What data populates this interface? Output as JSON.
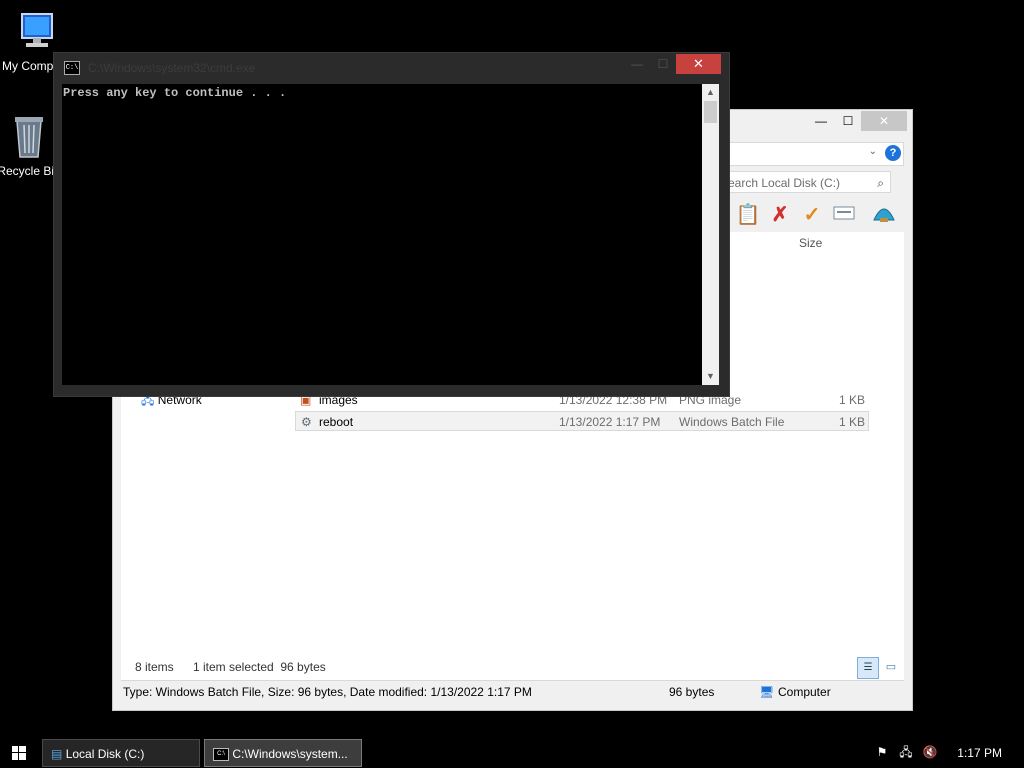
{
  "desktop": {
    "icons": [
      {
        "label": "My Computer",
        "icon": "computer-icon"
      },
      {
        "label": "Recycle Bin",
        "icon": "recycle-bin-icon"
      }
    ]
  },
  "console": {
    "title": "C:\\Windows\\system32\\cmd.exe",
    "output": "Press any key to continue . . .",
    "close_glyph": "✕",
    "min_glyph": "—",
    "max_glyph": "☐"
  },
  "explorer": {
    "search_placeholder": "Search Local Disk (C:)",
    "columns": {
      "size": "Size"
    },
    "nav": {
      "network": "Network"
    },
    "files": [
      {
        "name": "images",
        "date": "1/13/2022 12:38 PM",
        "type": "PNG image",
        "size": "1 KB",
        "icon": "png-file-icon",
        "selected": false
      },
      {
        "name": "reboot",
        "date": "1/13/2022 1:17 PM",
        "type": "Windows Batch File",
        "size": "1 KB",
        "icon": "batch-file-icon",
        "selected": true
      }
    ],
    "status": {
      "items": "8 items",
      "selection": "1 item selected  96 bytes"
    },
    "details_bar": {
      "info": "Type: Windows Batch File, Size: 96 bytes, Date modified: 1/13/2022 1:17 PM",
      "size": "96 bytes",
      "location": "Computer"
    },
    "window_buttons": {
      "minimize": "—",
      "maximize": "☐",
      "close": "✕"
    }
  },
  "taskbar": {
    "buttons": [
      {
        "label": "Local Disk (C:)",
        "icon": "folder-icon",
        "active": false
      },
      {
        "label": "C:\\Windows\\system...",
        "icon": "cmd-icon",
        "active": true
      }
    ],
    "clock": "1:17 PM",
    "tray": [
      "action-center-flag-icon",
      "network-icon",
      "volume-muted-icon"
    ]
  },
  "colors": {
    "console_close": "#c7413f",
    "console_text": "#c0c0c0",
    "desktop_bg": "#000000",
    "help_blue": "#1e73d8"
  }
}
